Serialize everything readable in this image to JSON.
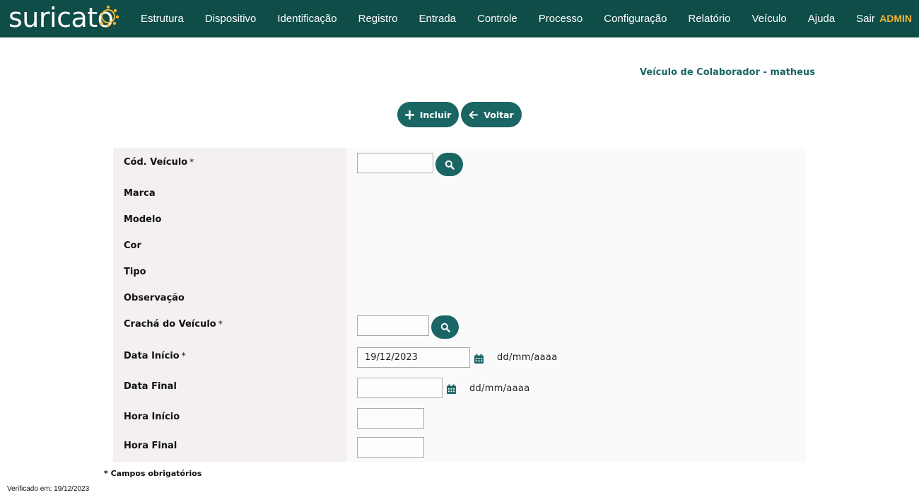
{
  "brand": {
    "logo_text": "suricato"
  },
  "nav": {
    "items": [
      "Estrutura",
      "Dispositivo",
      "Identificação",
      "Registro",
      "Entrada",
      "Controle",
      "Processo",
      "Configuração",
      "Relatório",
      "Veículo",
      "Ajuda",
      "Sair"
    ],
    "user": "ADMIN"
  },
  "page": {
    "title": "Veículo de Colaborador - matheus"
  },
  "actions": {
    "incluir": "Incluir",
    "voltar": "Voltar"
  },
  "form": {
    "required_mark": "*",
    "labels": {
      "cod_veiculo": "Cód. Veículo",
      "marca": "Marca",
      "modelo": "Modelo",
      "cor": "Cor",
      "tipo": "Tipo",
      "observacao": "Observação",
      "cracha_veiculo": "Crachá do Veículo",
      "data_inicio": "Data Início",
      "data_final": "Data Final",
      "hora_inicio": "Hora Início",
      "hora_final": "Hora Final"
    },
    "values": {
      "cod_veiculo": "",
      "cracha_veiculo": "",
      "data_inicio": "19/12/2023",
      "data_final": "",
      "hora_inicio": "",
      "hora_final": ""
    },
    "date_hint": "dd/mm/aaaa"
  },
  "footer": {
    "required_note": "* Campos obrigatórios",
    "verified": "Verificado em: 19/12/2023"
  },
  "colors": {
    "primary": "#1a6664",
    "header": "#0f4d48",
    "accent": "#f2b531"
  },
  "icons": [
    "logo-dots-icon",
    "plus-icon",
    "arrow-left-icon",
    "search-icon",
    "calendar-icon"
  ]
}
